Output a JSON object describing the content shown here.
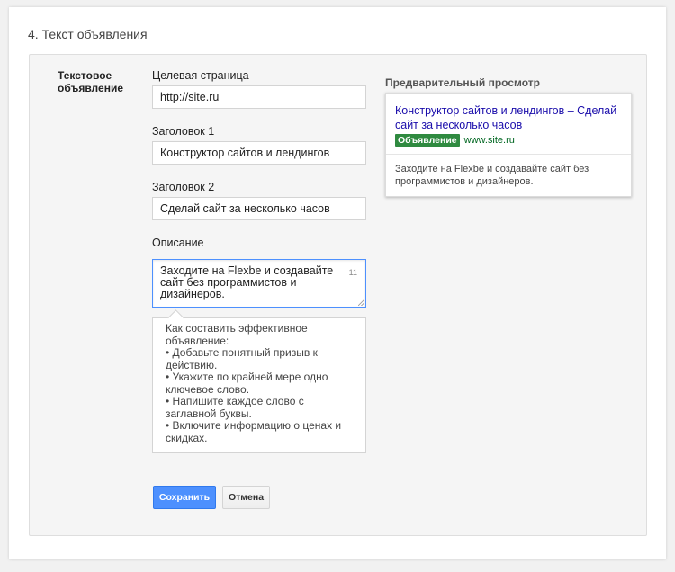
{
  "section": {
    "title": "4. Текст объявления"
  },
  "panel": {
    "label": "Текстовое объявление"
  },
  "form": {
    "landing_page": {
      "label": "Целевая страница",
      "value": "http://site.ru"
    },
    "headline1": {
      "label": "Заголовок 1",
      "value": "Конструктор сайтов и лендингов"
    },
    "headline2": {
      "label": "Заголовок 2",
      "value": "Сделай сайт за несколько часов"
    },
    "description": {
      "label": "Описание",
      "value": "Заходите на Flexbe и создавайте сайт без программистов и дизайнеров.",
      "char_count": "11"
    }
  },
  "tips": {
    "lines": [
      "Как составить эффективное",
      "объявление:",
      "• Добавьте понятный призыв к",
      "действию.",
      "• Укажите по крайней мере одно",
      "ключевое слово.",
      "• Напишите каждое слово с",
      "заглавной буквы.",
      "• Включите информацию о ценах и",
      "скидках."
    ]
  },
  "buttons": {
    "save": "Сохранить",
    "cancel": "Отмена"
  },
  "preview": {
    "title": "Предварительный просмотр",
    "headline": "Конструктор сайтов и лендингов – Сделай сайт за несколько часов",
    "badge": "Объявление",
    "url": "www.site.ru",
    "description": "Заходите на Flexbe и создавайте сайт без программистов и дизайнеров."
  },
  "colors": {
    "primary_button": "#4d90fe",
    "ad_link": "#1a0dab",
    "ad_badge": "#2f8a40",
    "ad_url": "#006621"
  }
}
